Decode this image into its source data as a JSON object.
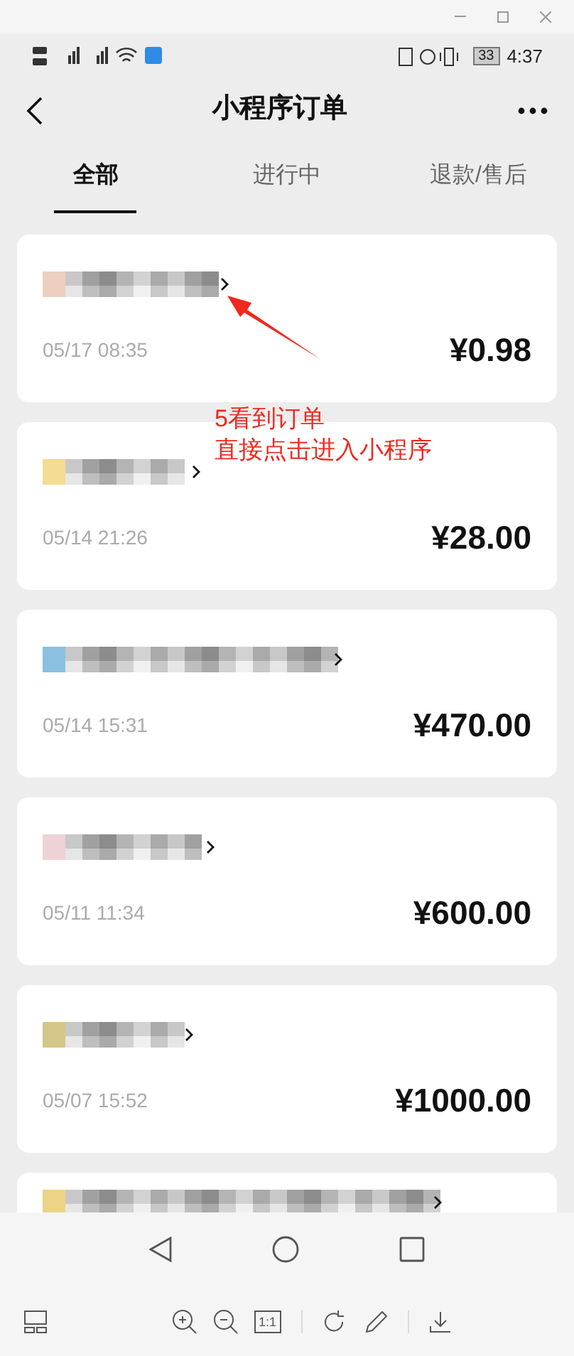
{
  "status_bar": {
    "battery": "33",
    "time": "4:37"
  },
  "header": {
    "title": "小程序订单"
  },
  "tabs": [
    {
      "label": "全部",
      "selected": true
    },
    {
      "label": "进行中",
      "selected": false
    },
    {
      "label": "退款/售后",
      "selected": false
    }
  ],
  "orders": [
    {
      "date": "05/17 08:35",
      "amount": "¥0.98"
    },
    {
      "date": "05/14 21:26",
      "amount": "¥28.00"
    },
    {
      "date": "05/14 15:31",
      "amount": "¥470.00"
    },
    {
      "date": "05/11 11:34",
      "amount": "¥600.00"
    },
    {
      "date": "05/07 15:52",
      "amount": "¥1000.00"
    },
    {
      "kind": "partial"
    }
  ],
  "annotation": {
    "lines": [
      "5看到订单",
      "直接点击进入小程序"
    ]
  },
  "viewer_toolbar": {
    "actual_size": "1:1"
  }
}
